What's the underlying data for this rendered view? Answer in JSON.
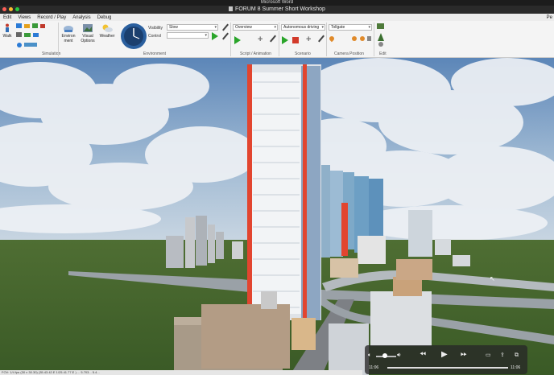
{
  "os": {
    "app_title": "Microsoft Word"
  },
  "window": {
    "title": "FORUM 8 Summer Short Workshop",
    "dot_colors": [
      "#ff5f57",
      "#febc2e",
      "#28c840"
    ]
  },
  "menu": {
    "items": [
      "Edit",
      "Views",
      "Record / Play",
      "Analysis",
      "Debug"
    ],
    "right": "Pe"
  },
  "ribbon": {
    "walk_label": "Walk",
    "environment_button_line1": "Environ",
    "environment_button_line2": "ment",
    "visual_options_line1": "Visual",
    "visual_options_line2": "Options",
    "weather_label": "Weather",
    "visibility_label": "Visibility",
    "visibility_value": "Slow",
    "control_label": "Control",
    "control_value": "",
    "script_value": "Overview",
    "scenario_value": "Autonomous driving",
    "camera_value": "Tollgate",
    "groups": {
      "simulation": "Simulation",
      "environment": "Environment",
      "script_animation": "Script / Animation",
      "scenario": "Scenario",
      "camera_position": "Camera Position",
      "edit": "Edit"
    }
  },
  "player": {
    "current_time": "11:06",
    "end_time": "11:06",
    "progress": 1.0,
    "volume": 0.35
  },
  "statusbar": {
    "text": "FOV: 1/4 fps  (30 x 30.30)        (35.43.42.E  1/25.41.77.E ) ...  5.703... 5.4..."
  },
  "colors": {
    "ribbon_bg": "#f4f4f4",
    "accent_green": "#2aa52a",
    "accent_red": "#d23a2a"
  }
}
